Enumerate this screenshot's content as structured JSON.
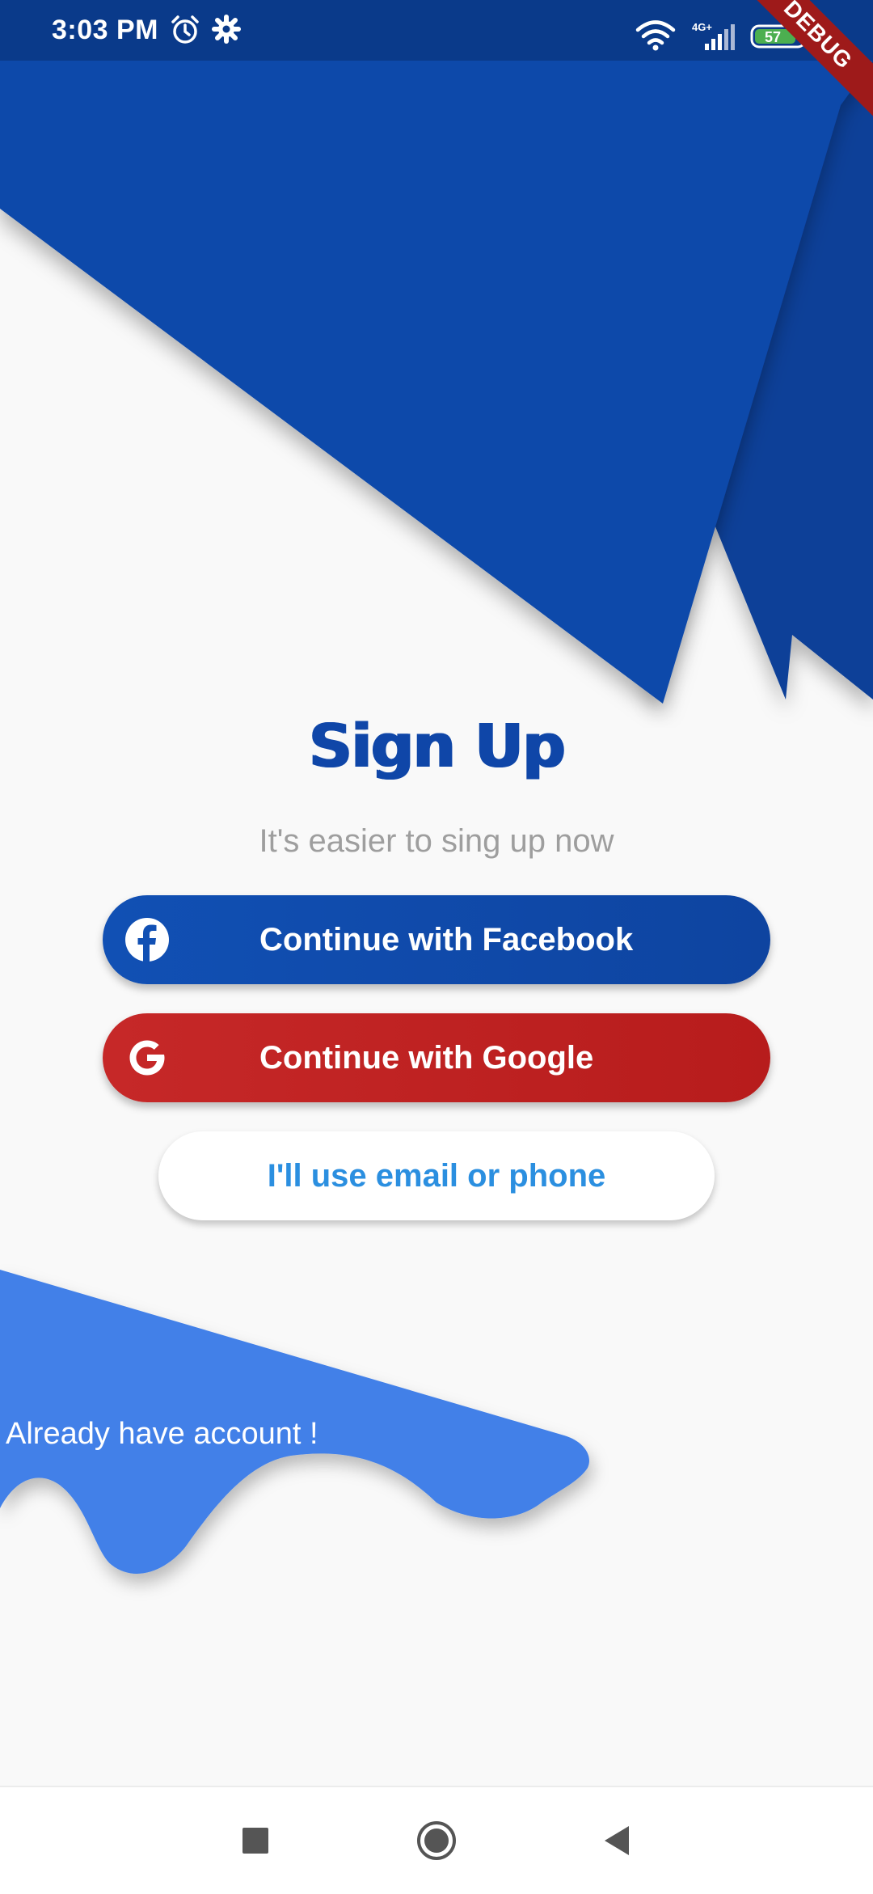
{
  "status_bar": {
    "time": "3:03 PM",
    "network": "4G+",
    "battery": "57",
    "debug_label": "DEBUG"
  },
  "signup": {
    "title": "Sign Up",
    "subtitle": "It's easier to sing up now"
  },
  "buttons": {
    "facebook_label": "Continue with Facebook",
    "google_label": "Continue with Google",
    "email_label": "I'll use email or phone"
  },
  "footer": {
    "already_label": "Already have account !"
  },
  "colors": {
    "primary_blue": "#0f46a8",
    "facebook_blue": "#1150b4",
    "google_red": "#c62828",
    "light_blue": "#4280e8",
    "link_blue": "#2b8fe0"
  },
  "icons": {
    "status": [
      "alarm-icon",
      "settings-icon",
      "wifi-icon",
      "signal-icon",
      "battery-icon"
    ],
    "buttons": [
      "facebook-icon",
      "google-icon"
    ],
    "nav": [
      "recent-apps-icon",
      "home-icon",
      "back-icon"
    ]
  }
}
